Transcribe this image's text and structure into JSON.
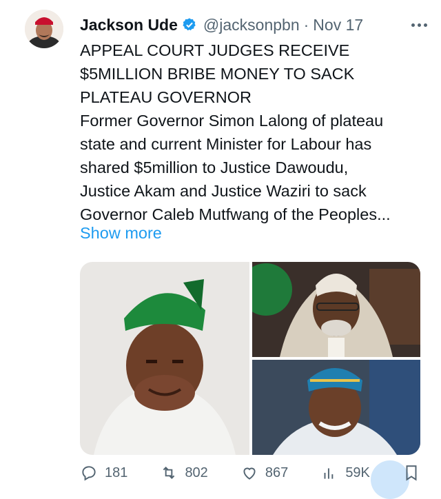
{
  "tweet": {
    "author_name": "Jackson Ude",
    "handle": "@jacksonpbn",
    "separator": "·",
    "date": "Nov 17",
    "headline_lines": [
      "APPEAL COURT JUDGES RECEIVE",
      "$5MILLION BRIBE MONEY TO SACK",
      "PLATEAU GOVERNOR"
    ],
    "body_lines": [
      "Former Governor Simon Lalong of plateau",
      "state and current Minister for Labour has",
      "shared $5million to Justice Dawoudu,",
      "Justice Akam and Justice Waziri to sack",
      "Governor Caleb Mutfwang of the Peoples..."
    ],
    "show_more": "Show more"
  },
  "actions": {
    "replies": "181",
    "reposts": "802",
    "likes": "867",
    "views": "59K"
  },
  "colors": {
    "accent": "#1d9bf0",
    "secondary_text": "#536471",
    "primary_text": "#0f1419"
  }
}
